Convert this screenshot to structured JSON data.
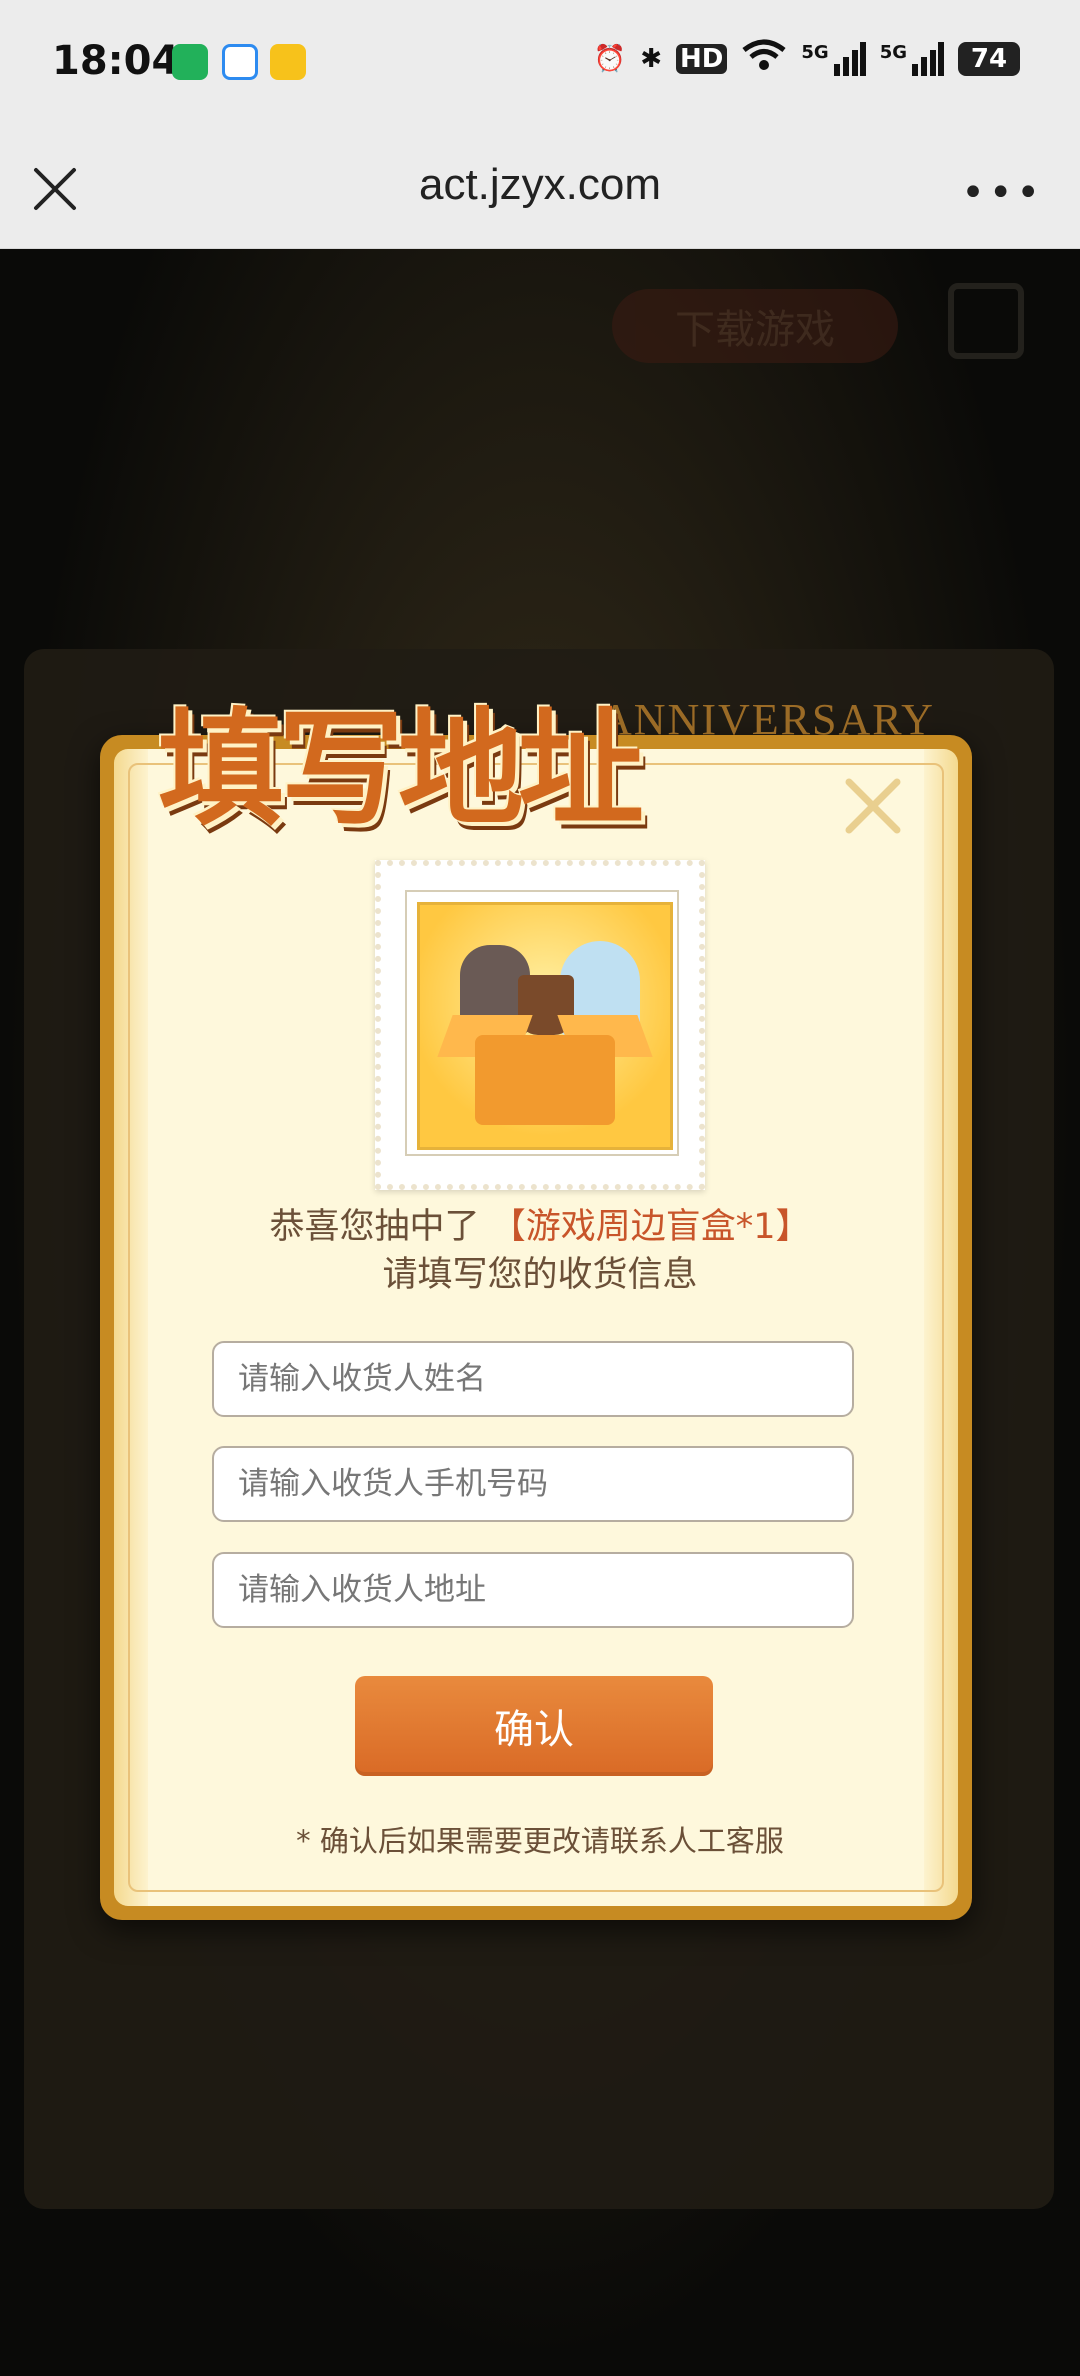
{
  "status_bar": {
    "time": "18:04",
    "hd_label": "HD",
    "net_label_1": "5G",
    "net_label_2": "5G",
    "battery": "74"
  },
  "browser": {
    "url": "act.jzyx.com",
    "close_icon": "close-icon",
    "more_icon": "more-icon",
    "more_glyph": "•••"
  },
  "background": {
    "download_button": "下载游戏"
  },
  "modal": {
    "title": "填写地址",
    "anniversary": "ANNIVERSARY",
    "congrats_prefix": "恭喜您抽中了",
    "prize": "【游戏周边盲盒*1】",
    "subline": "请填写您的收货信息",
    "fields": {
      "name_placeholder": "请输入收货人姓名",
      "phone_placeholder": "请输入收货人手机号码",
      "address_placeholder": "请输入收货人地址"
    },
    "confirm_label": "确认",
    "note": "* 确认后如果需要更改请联系人工客服"
  },
  "colors": {
    "accent": "#d96a26",
    "prize_text": "#c8552a",
    "card_frame": "#c78b22",
    "card_bg": "#fef8dc"
  }
}
